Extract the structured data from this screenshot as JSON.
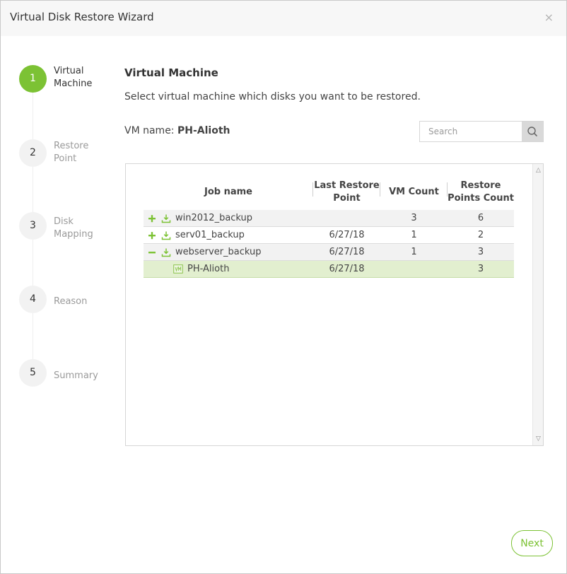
{
  "window": {
    "title": "Virtual Disk Restore Wizard",
    "close_glyph": "×"
  },
  "steps": [
    {
      "number": "1",
      "label": "Virtual Machine",
      "state": "active"
    },
    {
      "number": "2",
      "label": "Restore Point",
      "state": "pending"
    },
    {
      "number": "3",
      "label": "Disk Mapping",
      "state": "pending"
    },
    {
      "number": "4",
      "label": "Reason",
      "state": "pending"
    },
    {
      "number": "5",
      "label": "Summary",
      "state": "pending"
    }
  ],
  "main": {
    "title": "Virtual Machine",
    "description": "Select virtual machine which disks you want to be restored.",
    "vm_name_label": "VM name:",
    "vm_name_value": "PH-Alioth"
  },
  "search": {
    "placeholder": "Search",
    "value": "",
    "icon": "search-icon"
  },
  "table": {
    "columns": [
      "Job name",
      "Last Restore Point",
      "VM Count",
      "Restore Points Count"
    ],
    "rows": [
      {
        "type": "job",
        "expander": "plus",
        "name": "win2012_backup",
        "last_restore_point": "",
        "vm_count": "3",
        "restore_points_count": "6"
      },
      {
        "type": "job",
        "expander": "plus",
        "name": "serv01_backup",
        "last_restore_point": "6/27/18",
        "vm_count": "1",
        "restore_points_count": "2"
      },
      {
        "type": "job",
        "expander": "minus",
        "name": "webserver_backup",
        "last_restore_point": "6/27/18",
        "vm_count": "1",
        "restore_points_count": "3"
      },
      {
        "type": "vm",
        "selected": true,
        "name": "PH-Alioth",
        "last_restore_point": "6/27/18",
        "vm_count": "",
        "restore_points_count": "3"
      }
    ]
  },
  "footer": {
    "next_label": "Next"
  },
  "colors": {
    "accent": "#7cc234",
    "selected_row": "#e2efcf",
    "alt_row": "#f2f2f2"
  }
}
